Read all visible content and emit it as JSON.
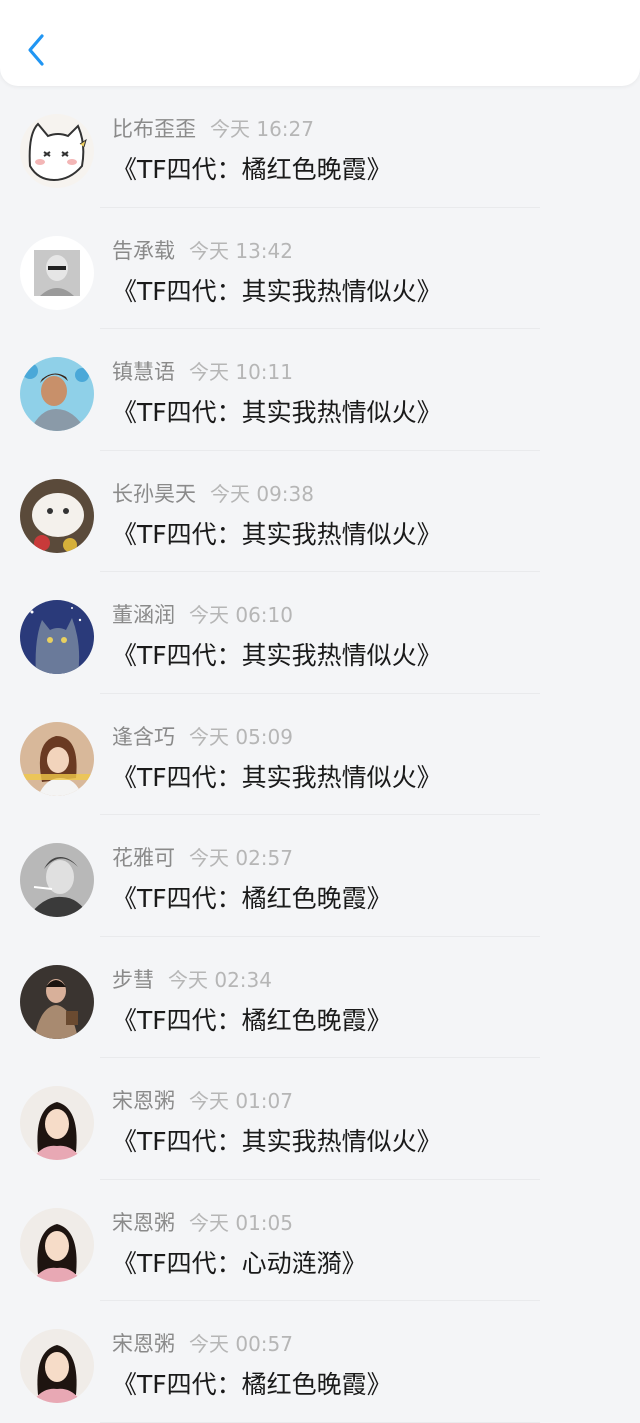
{
  "header": {
    "back_icon": "chevron-left-icon",
    "accent": "#2196f3"
  },
  "messages": [
    {
      "name": "比布歪歪",
      "time": "今天 16:27",
      "title": "《TF四代：橘红色晚霞》",
      "avatar_kind": "cartoon-cat"
    },
    {
      "name": "告承载",
      "time": "今天 13:42",
      "title": "《TF四代：其实我热情似火》",
      "avatar_kind": "square-photo"
    },
    {
      "name": "镇慧语",
      "time": "今天 10:11",
      "title": "《TF四代：其实我热情似火》",
      "avatar_kind": "man-photo"
    },
    {
      "name": "长孙昊天",
      "time": "今天 09:38",
      "title": "《TF四代：其实我热情似火》",
      "avatar_kind": "white-cat"
    },
    {
      "name": "董涵润",
      "time": "今天 06:10",
      "title": "《TF四代：其实我热情似火》",
      "avatar_kind": "blue-cat"
    },
    {
      "name": "逢含巧",
      "time": "今天 05:09",
      "title": "《TF四代：其实我热情似火》",
      "avatar_kind": "girl-photo"
    },
    {
      "name": "花雅可",
      "time": "今天 02:57",
      "title": "《TF四代：橘红色晚霞》",
      "avatar_kind": "bw-man"
    },
    {
      "name": "步彗",
      "time": "今天 02:34",
      "title": "《TF四代：橘红色晚霞》",
      "avatar_kind": "dark-photo"
    },
    {
      "name": "宋恩粥",
      "time": "今天 01:07",
      "title": "《TF四代：其实我热情似火》",
      "avatar_kind": "girl-portrait"
    },
    {
      "name": "宋恩粥",
      "time": "今天 01:05",
      "title": "《TF四代：心动涟漪》",
      "avatar_kind": "girl-portrait"
    },
    {
      "name": "宋恩粥",
      "time": "今天 00:57",
      "title": "《TF四代：橘红色晚霞》",
      "avatar_kind": "girl-portrait"
    }
  ]
}
